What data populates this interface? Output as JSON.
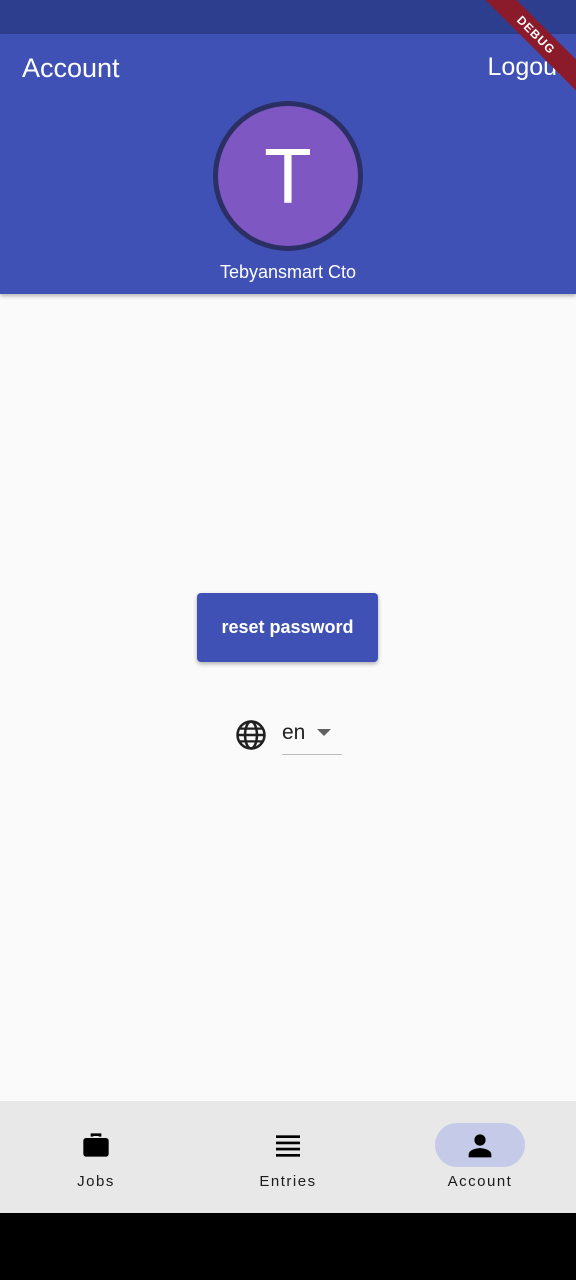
{
  "app_bar": {
    "title": "Account",
    "logout_label": "Logout",
    "avatar_initial": "T",
    "user_name": "Tebyansmart Cto",
    "debug_label": "DEBUG"
  },
  "main": {
    "reset_password_label": "reset password",
    "language": {
      "icon": "globe-icon",
      "selected": "en"
    }
  },
  "bottom_nav": {
    "items": [
      {
        "label": "Jobs",
        "icon": "work-icon",
        "active": false
      },
      {
        "label": "Entries",
        "icon": "list-icon",
        "active": false
      },
      {
        "label": "Account",
        "icon": "person-icon",
        "active": true
      }
    ]
  },
  "colors": {
    "primary": "#3f51b5",
    "status_bar": "#2e3e8f",
    "avatar": "#7e57c2",
    "nav_indicator": "#c5cae9",
    "debug_banner": "#8b1b2a"
  }
}
